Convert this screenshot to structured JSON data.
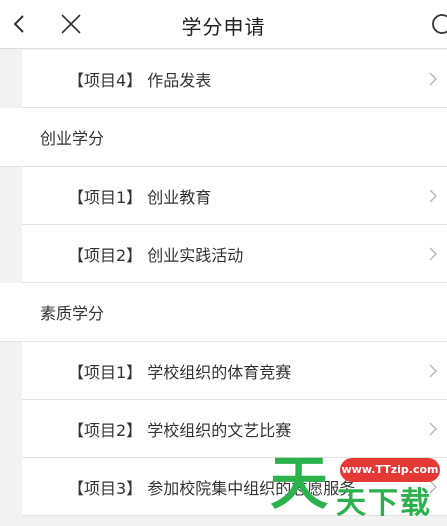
{
  "header": {
    "title": "学分申请"
  },
  "list": [
    {
      "type": "item",
      "label": "【项目4】 作品发表"
    },
    {
      "type": "section",
      "label": "创业学分"
    },
    {
      "type": "item",
      "label": "【项目1】 创业教育"
    },
    {
      "type": "item",
      "label": "【项目2】 创业实践活动"
    },
    {
      "type": "section",
      "label": "素质学分"
    },
    {
      "type": "item",
      "label": "【项目1】 学校组织的体育竞赛"
    },
    {
      "type": "item",
      "label": "【项目2】 学校组织的文艺比赛"
    },
    {
      "type": "item",
      "label": "【项目3】 参加校院集中组织的志愿服务"
    }
  ],
  "watermark": {
    "badge": "www.TTzip.com",
    "big_char": "天",
    "small_text": "天下载"
  },
  "colors": {
    "header_bg": "#ffffff",
    "page_bg": "#f2f2f2",
    "watermark_green": "#2bb24c",
    "watermark_red": "#e53935"
  }
}
